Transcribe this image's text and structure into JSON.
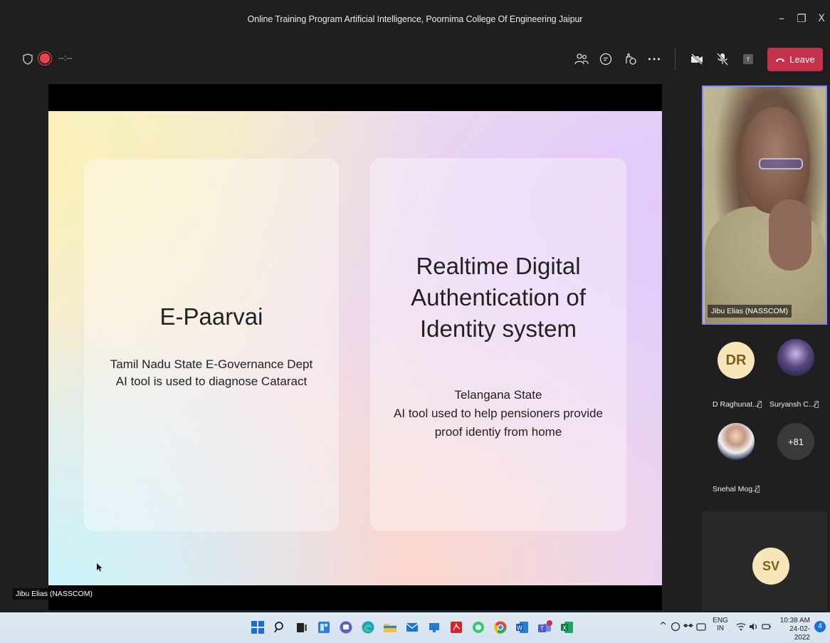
{
  "window": {
    "title": "Online Training Program Artificial Intelligence, Poornima College Of Engineering Jaipur",
    "minimize": "–",
    "maximize": "❐",
    "close": "X"
  },
  "toolbar": {
    "timer": "--:--",
    "leave_label": "Leave",
    "more_label": "•••"
  },
  "slide": {
    "left_title": "E-Paarvai",
    "left_sub_line1": "Tamil Nadu State E-Governance Dept",
    "left_sub_line2": "AI tool is used to diagnose Cataract",
    "right_title_line1": "Realtime Digital",
    "right_title_line2": "Authentication of",
    "right_title_line3": "Identity system",
    "right_sub_line1": "Telangana State",
    "right_sub_line2": "AI tool used to help pensioners provide",
    "right_sub_line3": "proof identiy from home"
  },
  "presenter_label": "Jibu Elias (NASSCOM)",
  "participants": {
    "featured_name": "Jibu Elias (NASSCOM)",
    "p1_initials": "DR",
    "p1_name": "D Raghunat...",
    "p2_name": "Suryansh C...",
    "p3_name": "Snehal Mog...",
    "more_count": "+81",
    "sv_initials": "SV"
  },
  "taskbar": {
    "lang_line1": "ENG",
    "lang_line2": "IN",
    "time": "10:38 AM",
    "date": "24-02-2022",
    "notif_count": "4"
  }
}
